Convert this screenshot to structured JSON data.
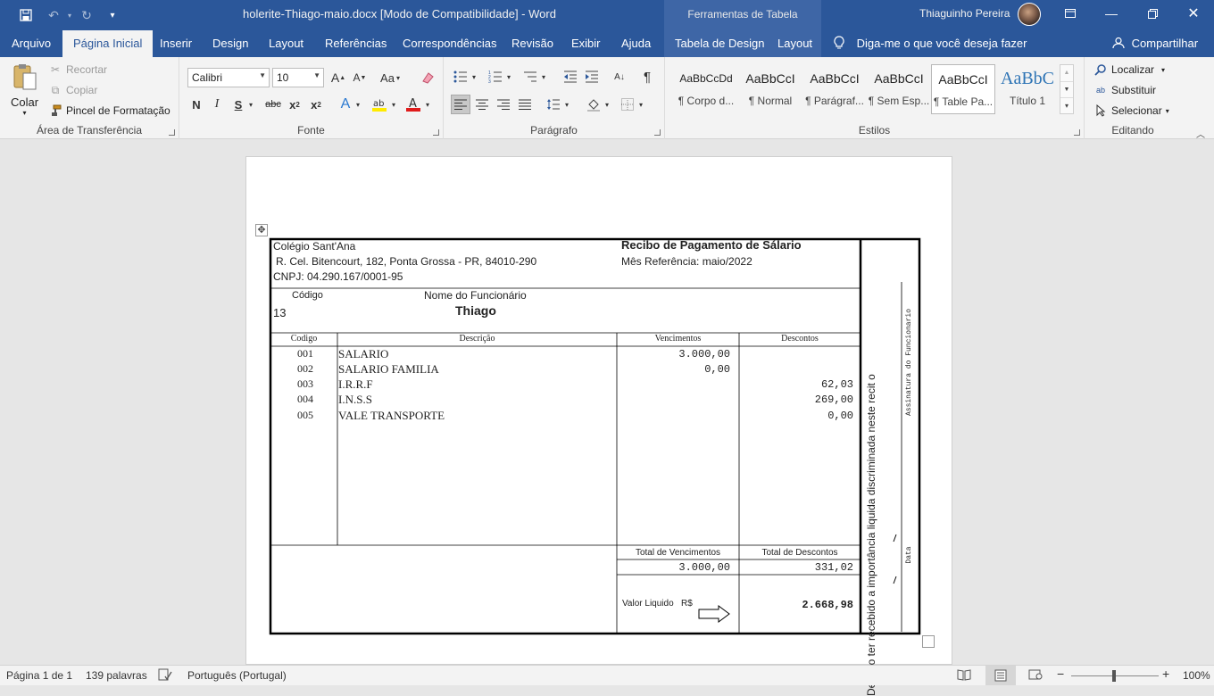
{
  "titlebar": {
    "doc_title": "holerite-Thiago-maio.docx [Modo de Compatibilidade]  -  Word",
    "table_tools": "Ferramentas de Tabela",
    "user": "Thiaguinho Pereira"
  },
  "tabs": [
    "Arquivo",
    "Página Inicial",
    "Inserir",
    "Design",
    "Layout",
    "Referências",
    "Correspondências",
    "Revisão",
    "Exibir",
    "Ajuda",
    "Tabela de Design",
    "Layout"
  ],
  "tell_me": "Diga-me o que você deseja fazer",
  "share": "Compartilhar",
  "clipboard": {
    "paste": "Colar",
    "cut": "Recortar",
    "copy": "Copiar",
    "format_painter": "Pincel de Formatação",
    "label": "Área de Transferência"
  },
  "font": {
    "name": "Calibri",
    "size": "10",
    "label": "Fonte"
  },
  "paragraph_label": "Parágrafo",
  "styles": {
    "items": [
      {
        "preview": "AaBbCcDd",
        "name": "¶ Corpo d..."
      },
      {
        "preview": "AaBbCcI",
        "name": "¶ Normal"
      },
      {
        "preview": "AaBbCcI",
        "name": "¶ Parágraf..."
      },
      {
        "preview": "AaBbCcI",
        "name": "¶ Sem Esp..."
      },
      {
        "preview": "AaBbCcI",
        "name": "¶ Table Pa..."
      },
      {
        "preview": "AaBbC",
        "name": "Título 1"
      }
    ],
    "label": "Estilos"
  },
  "editing": {
    "find": "Localizar",
    "replace": "Substituir",
    "select": "Selecionar",
    "label": "Editando"
  },
  "receipt": {
    "company": "Colégio Sant'Ana",
    "address": "R. Cel. Bitencourt, 182, Ponta Grossa - PR, 84010-290",
    "cnpj": "CNPJ: 04.290.167/0001-95",
    "title": "Recibo de Pagamento de Sálario",
    "month": "Mês Referência: maio/2022",
    "code_header": "Código",
    "name_header": "Nome do Funcionário",
    "code": "13",
    "name": "Thiago",
    "columns": [
      "Codigo",
      "Descrição",
      "Vencimentos",
      "Descontos"
    ],
    "rows": [
      {
        "code": "001",
        "desc": "SALARIO",
        "earn": "3.000,00",
        "ded": ""
      },
      {
        "code": "002",
        "desc": "SALARIO FAMILIA",
        "earn": "0,00",
        "ded": ""
      },
      {
        "code": "003",
        "desc": "I.R.R.F",
        "earn": "",
        "ded": "62,03"
      },
      {
        "code": "004",
        "desc": "I.N.S.S",
        "earn": "",
        "ded": "269,00"
      },
      {
        "code": "005",
        "desc": "VALE TRANSPORTE",
        "earn": "",
        "ded": "0,00"
      }
    ],
    "total_earn_label": "Total de Vencimentos",
    "total_ded_label": "Total de Descontos",
    "total_earn": "3.000,00",
    "total_ded": "331,02",
    "net_label": "Valor Liquido   R$",
    "net_value": "2.668,98",
    "declaration": "Declaro  ter recebido a importância  liquida discriminada neste recit o",
    "signature": "Assinatura do Funcionario",
    "date": "Data"
  },
  "status": {
    "page": "Página 1 de 1",
    "words": "139 palavras",
    "language": "Português (Portugal)",
    "zoom": "100%"
  }
}
